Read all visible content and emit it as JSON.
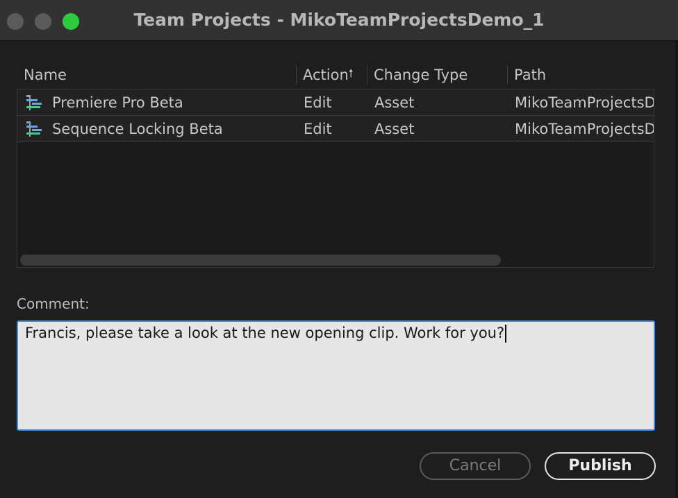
{
  "window": {
    "title": "Team Projects - MikoTeamProjectsDemo_1"
  },
  "table": {
    "columns": {
      "name": "Name",
      "action": "Action",
      "change_type": "Change Type",
      "path": "Path"
    },
    "sort_indicator": "arrow-up-icon",
    "rows": [
      {
        "icon": "sequence-icon",
        "name": "Premiere Pro Beta",
        "action": "Edit",
        "change_type": "Asset",
        "path": "MikoTeamProjectsDe"
      },
      {
        "icon": "sequence-icon",
        "name": "Sequence Locking Beta",
        "action": "Edit",
        "change_type": "Asset",
        "path": "MikoTeamProjectsDe"
      }
    ]
  },
  "comment": {
    "label": "Comment:",
    "value": "Francis, please take a look at the new opening clip. Work for you?"
  },
  "buttons": {
    "cancel": "Cancel",
    "publish": "Publish"
  },
  "colors": {
    "close": "#5a5a5a",
    "minimize": "#5a5a5a",
    "zoom": "#2ecb3f",
    "focus_border": "#3f8ee8"
  }
}
